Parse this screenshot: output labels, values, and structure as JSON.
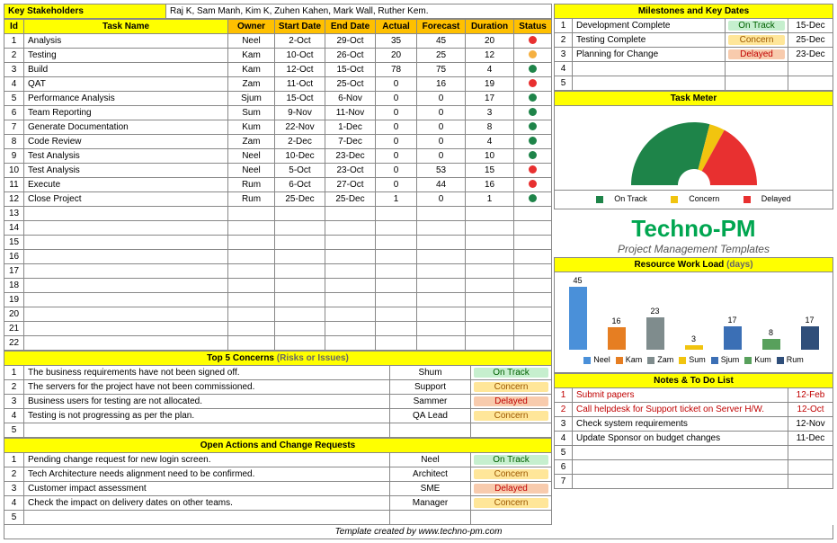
{
  "stakeholders_label": "Key Stakeholders",
  "stakeholders_value": "Raj K, Sam Manh, Kim K, Zuhen Kahen, Mark Wall, Ruther Kem.",
  "task_headers": [
    "Id",
    "Task Name",
    "Owner",
    "Start Date",
    "End Date",
    "Actual",
    "Forecast",
    "Duration",
    "Status"
  ],
  "tasks": [
    {
      "id": "1",
      "name": "Analysis",
      "owner": "Neel",
      "start": "2-Oct",
      "end": "29-Oct",
      "actual": "35",
      "forecast": "45",
      "duration": "20",
      "status": "red"
    },
    {
      "id": "2",
      "name": "Testing",
      "owner": "Kam",
      "start": "10-Oct",
      "end": "26-Oct",
      "actual": "20",
      "forecast": "25",
      "duration": "12",
      "status": "orange"
    },
    {
      "id": "3",
      "name": "Build",
      "owner": "Kam",
      "start": "12-Oct",
      "end": "15-Oct",
      "actual": "78",
      "forecast": "75",
      "duration": "4",
      "status": "green"
    },
    {
      "id": "4",
      "name": "QAT",
      "owner": "Zam",
      "start": "11-Oct",
      "end": "25-Oct",
      "actual": "0",
      "forecast": "16",
      "duration": "19",
      "status": "red"
    },
    {
      "id": "5",
      "name": "Performance Analysis",
      "owner": "Sjum",
      "start": "15-Oct",
      "end": "6-Nov",
      "actual": "0",
      "forecast": "0",
      "duration": "17",
      "status": "green"
    },
    {
      "id": "6",
      "name": "Team Reporting",
      "owner": "Sum",
      "start": "9-Nov",
      "end": "11-Nov",
      "actual": "0",
      "forecast": "0",
      "duration": "3",
      "status": "green"
    },
    {
      "id": "7",
      "name": "Generate Documentation",
      "owner": "Kum",
      "start": "22-Nov",
      "end": "1-Dec",
      "actual": "0",
      "forecast": "0",
      "duration": "8",
      "status": "green"
    },
    {
      "id": "8",
      "name": "Code Review",
      "owner": "Zam",
      "start": "2-Dec",
      "end": "7-Dec",
      "actual": "0",
      "forecast": "0",
      "duration": "4",
      "status": "green"
    },
    {
      "id": "9",
      "name": "Test Analysis",
      "owner": "Neel",
      "start": "10-Dec",
      "end": "23-Dec",
      "actual": "0",
      "forecast": "0",
      "duration": "10",
      "status": "green"
    },
    {
      "id": "10",
      "name": "Test Analysis",
      "owner": "Neel",
      "start": "5-Oct",
      "end": "23-Oct",
      "actual": "0",
      "forecast": "53",
      "duration": "15",
      "status": "red"
    },
    {
      "id": "11",
      "name": "Execute",
      "owner": "Rum",
      "start": "6-Oct",
      "end": "27-Oct",
      "actual": "0",
      "forecast": "44",
      "duration": "16",
      "status": "red"
    },
    {
      "id": "12",
      "name": "Close Project",
      "owner": "Rum",
      "start": "25-Dec",
      "end": "25-Dec",
      "actual": "1",
      "forecast": "0",
      "duration": "1",
      "status": "green"
    }
  ],
  "empty_task_ids": [
    "13",
    "14",
    "15",
    "16",
    "17",
    "18",
    "19",
    "20",
    "21",
    "22"
  ],
  "concerns_header": "Top 5 Concerns",
  "concerns_header_sub": "(Risks or Issues)",
  "concerns": [
    {
      "id": "1",
      "text": "The business requirements have not been signed off.",
      "owner": "Shum",
      "status": "On Track",
      "cls": "on"
    },
    {
      "id": "2",
      "text": "The servers for the project have not been commissioned.",
      "owner": "Support",
      "status": "Concern",
      "cls": "concern"
    },
    {
      "id": "3",
      "text": "Business users for testing are not allocated.",
      "owner": "Sammer",
      "status": "Delayed",
      "cls": "delayed"
    },
    {
      "id": "4",
      "text": "Testing is not progressing as per the plan.",
      "owner": "QA Lead",
      "status": "Concern",
      "cls": "concern"
    },
    {
      "id": "5",
      "text": "",
      "owner": "",
      "status": "",
      "cls": ""
    }
  ],
  "actions_header": "Open Actions and Change Requests",
  "actions": [
    {
      "id": "1",
      "text": "Pending change request for new login screen.",
      "owner": "Neel",
      "status": "On Track",
      "cls": "on"
    },
    {
      "id": "2",
      "text": "Tech Architecture needs alignment need to be confirmed.",
      "owner": "Architect",
      "status": "Concern",
      "cls": "concern"
    },
    {
      "id": "3",
      "text": "Customer impact assessment",
      "owner": "SME",
      "status": "Delayed",
      "cls": "delayed"
    },
    {
      "id": "4",
      "text": "Check the impact on delivery dates on other teams.",
      "owner": "Manager",
      "status": "Concern",
      "cls": "concern"
    },
    {
      "id": "5",
      "text": "",
      "owner": "",
      "status": "",
      "cls": ""
    }
  ],
  "milestones_header": "Milestones and Key Dates",
  "milestones": [
    {
      "id": "1",
      "text": "Development Complete",
      "status": "On Track",
      "cls": "on",
      "date": "15-Dec"
    },
    {
      "id": "2",
      "text": "Testing Complete",
      "status": "Concern",
      "cls": "concern",
      "date": "25-Dec"
    },
    {
      "id": "3",
      "text": "Planning for Change",
      "status": "Delayed",
      "cls": "delayed",
      "date": "23-Dec"
    },
    {
      "id": "4",
      "text": "",
      "status": "",
      "cls": "",
      "date": ""
    },
    {
      "id": "5",
      "text": "",
      "status": "",
      "cls": "",
      "date": ""
    }
  ],
  "meter_header": "Task Meter",
  "meter_legend": {
    "on": "On Track",
    "concern": "Concern",
    "delayed": "Delayed"
  },
  "resource_header": "Resource Work Load",
  "resource_header_sub": "(days)",
  "notes_header": "Notes & To Do List",
  "notes": [
    {
      "id": "1",
      "text": "Submit papers",
      "date": "12-Feb",
      "red": true
    },
    {
      "id": "2",
      "text": "Call helpdesk for Support ticket on Server H/W.",
      "date": "12-Oct",
      "red": true
    },
    {
      "id": "3",
      "text": "Check system requirements",
      "date": "12-Nov",
      "red": false
    },
    {
      "id": "4",
      "text": "Update Sponsor on budget changes",
      "date": "11-Dec",
      "red": false
    },
    {
      "id": "5",
      "text": "",
      "date": "",
      "red": false
    },
    {
      "id": "6",
      "text": "",
      "date": "",
      "red": false
    },
    {
      "id": "7",
      "text": "",
      "date": "",
      "red": false
    }
  ],
  "footer": "Template created by www.techno-pm.com",
  "logo_title": "Techno-PM",
  "logo_sub": "Project Management Templates",
  "chart_data": {
    "gauge": {
      "type": "pie",
      "segments": [
        {
          "name": "On Track",
          "value": 58,
          "color": "#1e8449"
        },
        {
          "name": "Concern",
          "value": 8,
          "color": "#f1c40f"
        },
        {
          "name": "Delayed",
          "value": 34,
          "color": "#e83030"
        }
      ]
    },
    "bars": {
      "type": "bar",
      "categories": [
        "Neel",
        "Kam",
        "Zam",
        "Sum",
        "Sjum",
        "Kum",
        "Rum"
      ],
      "values": [
        45,
        16,
        23,
        3,
        17,
        8,
        17
      ],
      "colors": [
        "#4a90d9",
        "#e67e22",
        "#7f8c8d",
        "#f1c40f",
        "#3b6fb5",
        "#58a05c",
        "#2f4e7a"
      ]
    }
  }
}
